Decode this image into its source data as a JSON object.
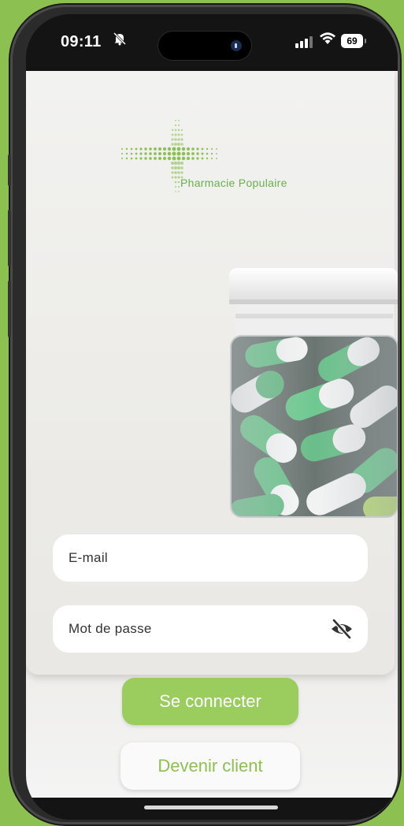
{
  "status": {
    "time": "09:11",
    "battery": "69"
  },
  "brand": {
    "name": "Pharmacie Populaire",
    "accent": "#8cc152"
  },
  "form": {
    "email_placeholder": "E-mail",
    "password_placeholder": "Mot de passe"
  },
  "actions": {
    "login_label": "Se connecter",
    "register_label": "Devenir client"
  },
  "icons": {
    "mute": "bell-slash-icon",
    "signal": "signal-icon",
    "wifi": "wifi-icon",
    "toggle_password": "eye-slash-icon"
  }
}
